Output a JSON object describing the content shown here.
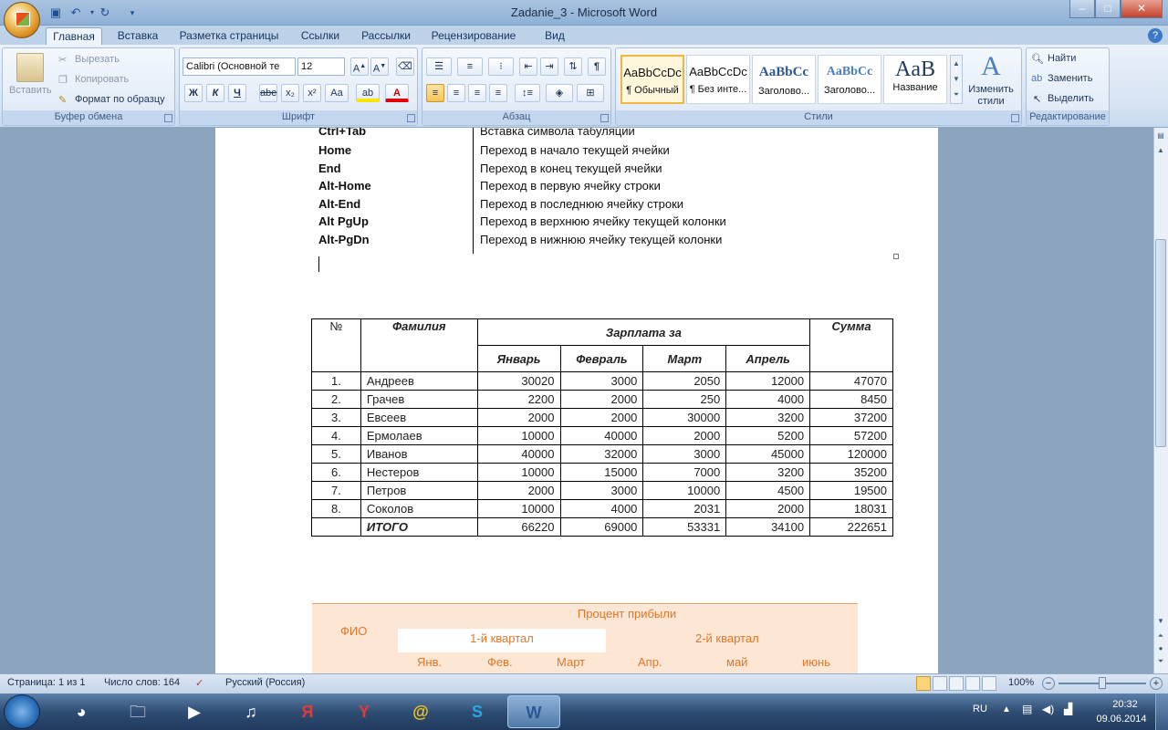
{
  "window": {
    "title": "Zadanie_3 - Microsoft Word",
    "minimize": "–",
    "maximize": "□",
    "close": "✕"
  },
  "tabs": [
    "Главная",
    "Вставка",
    "Разметка страницы",
    "Ссылки",
    "Рассылки",
    "Рецензирование",
    "Вид"
  ],
  "clipboard": {
    "paste": "Вставить",
    "cut": "Вырезать",
    "copy": "Копировать",
    "format_painter": "Формат по образцу",
    "label": "Буфер обмена"
  },
  "font": {
    "name": "Calibri (Основной те",
    "size": "12",
    "label": "Шрифт",
    "bold": "Ж",
    "italic": "К",
    "underline": "Ч",
    "strike": "abe",
    "sub": "x₂",
    "sup": "x²",
    "case": "Aa"
  },
  "paragraph": {
    "label": "Абзац"
  },
  "styles": {
    "label": "Стили",
    "items": [
      {
        "preview": "AaBbCcDc",
        "name": "¶ Обычный"
      },
      {
        "preview": "AaBbCcDc",
        "name": "¶ Без инте..."
      },
      {
        "preview": "AaBbCc",
        "name": "Заголово..."
      },
      {
        "preview": "AaBbCc",
        "name": "Заголово..."
      },
      {
        "preview": "AaB",
        "name": "Название"
      }
    ],
    "change": "Изменить стили"
  },
  "editing": {
    "find": "Найти",
    "replace": "Заменить",
    "select": "Выделить",
    "label": "Редактирование"
  },
  "shortcuts": [
    {
      "key": "Ctrl+Tab",
      "desc": "Вставка символа табуляции"
    },
    {
      "key": "Home",
      "desc": "Переход в начало текущей ячейки"
    },
    {
      "key": "End",
      "desc": "Переход в конец текущей ячейки"
    },
    {
      "key": "Alt-Home",
      "desc": "Переход в первую ячейку строки"
    },
    {
      "key": "Alt-End",
      "desc": "Переход в последнюю ячейку строки"
    },
    {
      "key": "Alt PgUp",
      "desc": "Переход в верхнюю ячейку текущей колонки"
    },
    {
      "key": "Alt-PgDn",
      "desc": "Переход в нижнюю ячейку текущей колонки"
    }
  ],
  "salary_table": {
    "headers": {
      "num": "№",
      "name": "Фамилия",
      "salary": "Зарплата за",
      "sum": "Сумма",
      "months": [
        "Январь",
        "Февраль",
        "Март",
        "Апрель"
      ]
    },
    "rows": [
      {
        "n": "1.",
        "name": "Андреев",
        "v": [
          "30020",
          "3000",
          "2050",
          "12000"
        ],
        "sum": "47070"
      },
      {
        "n": "2.",
        "name": "Грачев",
        "v": [
          "2200",
          "2000",
          "250",
          "4000"
        ],
        "sum": "8450"
      },
      {
        "n": "3.",
        "name": "Евсеев",
        "v": [
          "2000",
          "2000",
          "30000",
          "3200"
        ],
        "sum": "37200"
      },
      {
        "n": "4.",
        "name": "Ермолаев",
        "v": [
          "10000",
          "40000",
          "2000",
          "5200"
        ],
        "sum": "57200"
      },
      {
        "n": "5.",
        "name": "Иванов",
        "v": [
          "40000",
          "32000",
          "3000",
          "45000"
        ],
        "sum": "120000"
      },
      {
        "n": "6.",
        "name": "Нестеров",
        "v": [
          "10000",
          "15000",
          "7000",
          "3200"
        ],
        "sum": "35200"
      },
      {
        "n": "7.",
        "name": "Петров",
        "v": [
          "2000",
          "3000",
          "10000",
          "4500"
        ],
        "sum": "19500"
      },
      {
        "n": "8.",
        "name": "Соколов",
        "v": [
          "10000",
          "4000",
          "2031",
          "2000"
        ],
        "sum": "18031"
      }
    ],
    "total": {
      "label": "ИТОГО",
      "v": [
        "66220",
        "69000",
        "53331",
        "34100"
      ],
      "sum": "222651"
    }
  },
  "profit_table": {
    "title": "Процент прибыли",
    "fio": "ФИО",
    "q1": "1-й квартал",
    "q2": "2-й квартал",
    "months": [
      "Янв.",
      "Фев.",
      "Март",
      "Апр.",
      "май",
      "июнь"
    ]
  },
  "statusbar": {
    "page": "Страница: 1 из 1",
    "words": "Число слов: 164",
    "lang": "Русский (Россия)",
    "zoom": "100%"
  },
  "taskbar": {
    "lang": "RU",
    "time": "20:32",
    "date": "09.06.2014"
  }
}
